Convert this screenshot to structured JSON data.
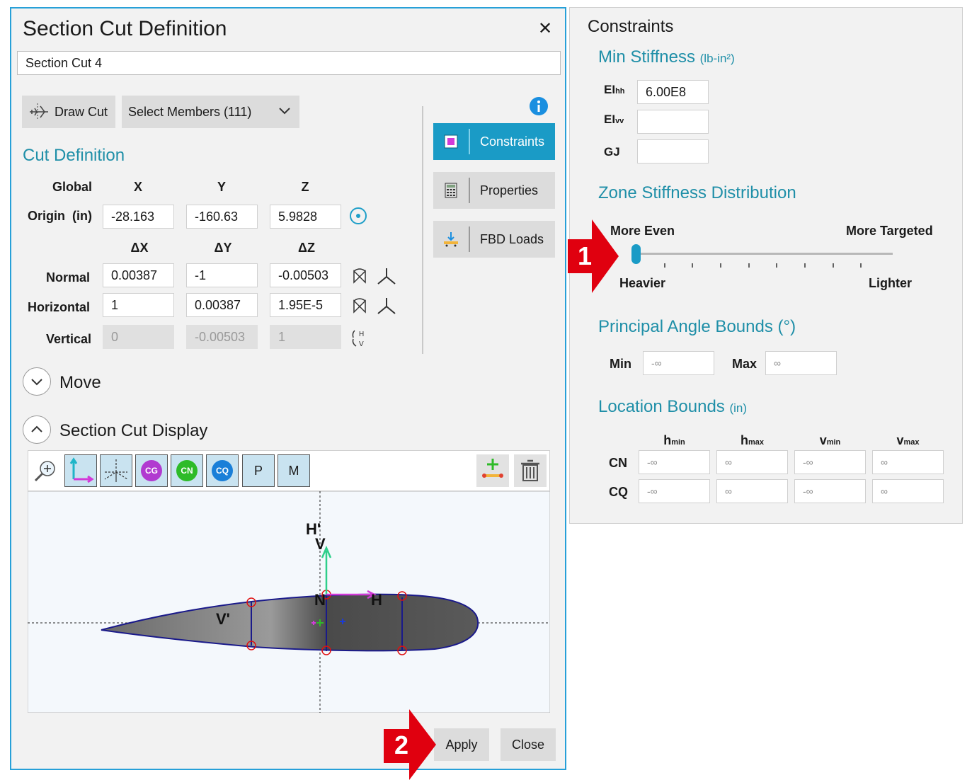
{
  "dialog": {
    "title": "Section Cut Definition",
    "close_glyph": "✕",
    "name_value": "Section Cut 4",
    "draw_cut_label": "Draw Cut",
    "select_members_label": "Select Members (111)",
    "cut_definition_heading": "Cut Definition",
    "grid": {
      "global_label": "Global",
      "x_header": "X",
      "y_header": "Y",
      "z_header": "Z",
      "origin_label": "Origin",
      "origin_unit": "(in)",
      "origin": [
        "-28.163",
        "-160.63",
        "5.9828"
      ],
      "dx_header": "ΔX",
      "dy_header": "ΔY",
      "dz_header": "ΔZ",
      "normal_label": "Normal",
      "normal": [
        "0.00387",
        "-1",
        "-0.00503"
      ],
      "horizontal_label": "Horizontal",
      "horizontal": [
        "1",
        "0.00387",
        "1.95E-5"
      ],
      "vertical_label": "Vertical",
      "vertical": [
        "0",
        "-0.00503",
        "1"
      ]
    },
    "side_buttons": {
      "constraints": "Constraints",
      "properties": "Properties",
      "fbd_loads": "FBD Loads"
    },
    "move_label": "Move",
    "display_label": "Section Cut Display",
    "toolbar": {
      "cg": "CG",
      "cn": "CN",
      "cq": "CQ",
      "p": "P",
      "m": "M"
    },
    "plot_labels": {
      "h_prime": "H'",
      "v": "V",
      "v_prime": "V'",
      "n": "N",
      "h": "H"
    },
    "apply_label": "Apply",
    "close_label": "Close"
  },
  "constraints": {
    "title": "Constraints",
    "min_stiffness": {
      "heading": "Min Stiffness",
      "unit": "(lb-in²)",
      "eihh_label": "EI",
      "eihh_sub": "hh",
      "eihh_value": "6.00E8",
      "eivv_label": "EI",
      "eivv_sub": "vv",
      "eivv_value": "",
      "gj_label": "GJ",
      "gj_value": ""
    },
    "zone": {
      "heading": "Zone Stiffness Distribution",
      "more_even": "More Even",
      "more_targeted": "More Targeted",
      "heavier": "Heavier",
      "lighter": "Lighter",
      "slider_value": 0
    },
    "angle": {
      "heading": "Principal Angle Bounds (°)",
      "min_label": "Min",
      "min_value": "-∞",
      "max_label": "Max",
      "max_value": "∞"
    },
    "location": {
      "heading": "Location Bounds",
      "unit": "(in)",
      "headers": [
        {
          "base": "h",
          "sub": "min"
        },
        {
          "base": "h",
          "sub": "max"
        },
        {
          "base": "v",
          "sub": "min"
        },
        {
          "base": "v",
          "sub": "max"
        }
      ],
      "rows": [
        {
          "label": "CN",
          "values": [
            "-∞",
            "∞",
            "-∞",
            "∞"
          ]
        },
        {
          "label": "CQ",
          "values": [
            "-∞",
            "∞",
            "-∞",
            "∞"
          ]
        }
      ]
    }
  },
  "callouts": {
    "one": "1",
    "two": "2"
  },
  "colors": {
    "accent": "#1f8fa8",
    "selected": "#1a9bc6",
    "callout": "#e0000f"
  }
}
